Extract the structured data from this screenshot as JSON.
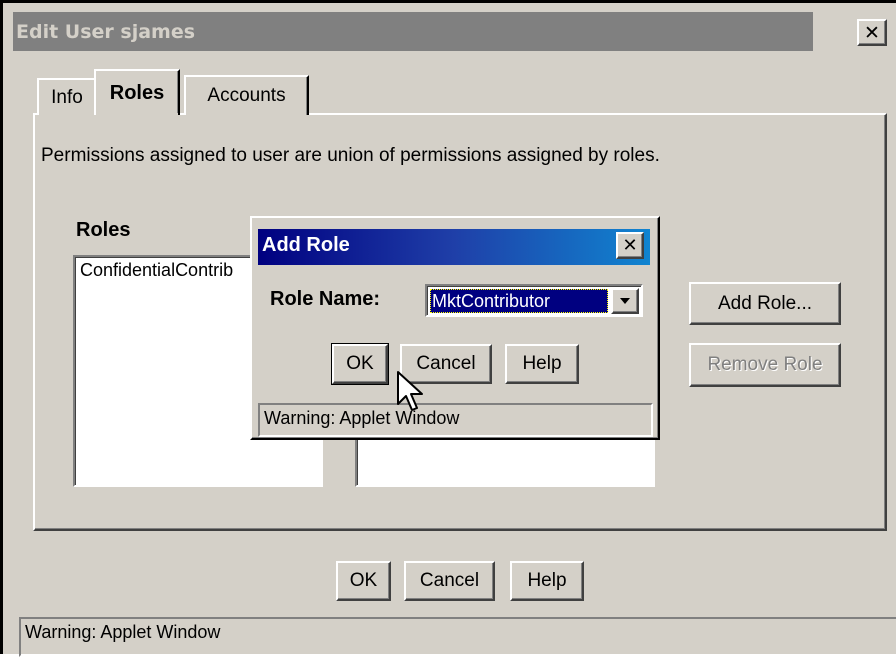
{
  "window": {
    "title": "Edit User sjames",
    "close_symbol": "✕"
  },
  "tabs": [
    {
      "label": "Info",
      "active": false
    },
    {
      "label": "Roles",
      "active": true
    },
    {
      "label": "Accounts",
      "active": false
    }
  ],
  "roles_panel": {
    "description": "Permissions assigned to user are union of permissions assigned by roles.",
    "roles_label": "Roles",
    "roles_list": [
      "ConfidentialContrib"
    ],
    "add_role_label": "Add Role...",
    "remove_role_label": "Remove Role"
  },
  "footer": {
    "ok_label": "OK",
    "cancel_label": "Cancel",
    "help_label": "Help",
    "status": "Warning: Applet Window"
  },
  "dialog": {
    "title": "Add Role",
    "close_symbol": "✕",
    "role_name_label": "Role Name:",
    "role_name_value": "MktContributor",
    "ok_label": "OK",
    "cancel_label": "Cancel",
    "help_label": "Help",
    "status": "Warning: Applet Window"
  },
  "icons": {
    "close": "close-icon",
    "dropdown": "chevron-down-icon",
    "cursor": "mouse-pointer-icon"
  },
  "colors": {
    "window_bg": "#d4d0c8",
    "inactive_title": "#808080",
    "active_title_start": "#000080",
    "active_title_end": "#1084d0",
    "selection": "#000080"
  }
}
